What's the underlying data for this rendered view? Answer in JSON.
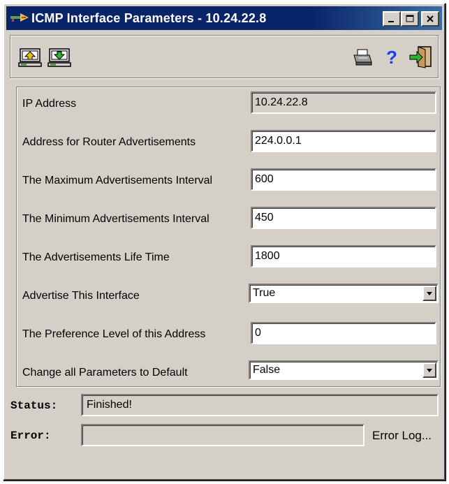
{
  "window": {
    "title": "ICMP Interface Parameters - 10.24.22.8"
  },
  "titlebar_buttons": {
    "minimize": "_",
    "maximize": "□",
    "close": "✕"
  },
  "toolbar": {
    "icons": [
      "upload-icon",
      "download-icon",
      "print-icon",
      "help-icon",
      "exit-icon"
    ],
    "help_glyph": "?"
  },
  "params": [
    {
      "label": "IP Address",
      "value": "10.24.22.8",
      "type": "readonly"
    },
    {
      "label": "Address for Router Advertisements",
      "value": "224.0.0.1",
      "type": "text"
    },
    {
      "label": "The Maximum Advertisements Interval",
      "value": "600",
      "type": "text"
    },
    {
      "label": "The Minimum Advertisements Interval",
      "value": "450",
      "type": "text"
    },
    {
      "label": "The Advertisements Life Time",
      "value": "1800",
      "type": "text"
    },
    {
      "label": "Advertise This Interface",
      "value": "True",
      "type": "select"
    },
    {
      "label": "The Preference Level of this Address",
      "value": "0",
      "type": "text"
    },
    {
      "label": "Change all Parameters to Default",
      "value": "False",
      "type": "select"
    }
  ],
  "status": {
    "label": "Status:",
    "value": "Finished!"
  },
  "error": {
    "label": "Error:",
    "value": "",
    "log_link": "Error Log..."
  },
  "colors": {
    "titlebar": "#0a246a",
    "face": "#d4d0c8",
    "help": "#1a3cff"
  }
}
